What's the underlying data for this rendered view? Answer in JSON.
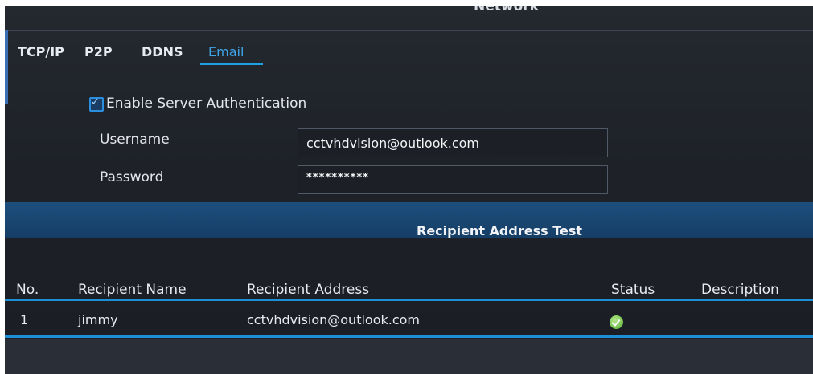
{
  "window": {
    "title": "Network"
  },
  "tabs": [
    {
      "label": "TCP/IP",
      "active": false
    },
    {
      "label": "P2P",
      "active": false
    },
    {
      "label": "DDNS",
      "active": false
    },
    {
      "label": "Email",
      "active": true
    }
  ],
  "auth": {
    "enable_label": "Enable Server Authentication",
    "enabled": true,
    "username_label": "Username",
    "username_value": "cctvhdvision@outlook.com",
    "password_label": "Password",
    "password_value": "**********"
  },
  "recipient_section": {
    "title": "Recipient Address Test",
    "columns": [
      "No.",
      "Recipient Name",
      "Recipient Address",
      "Status",
      "Description"
    ],
    "rows": [
      {
        "no": "1",
        "name": "jimmy",
        "address": "cctvhdvision@outlook.com",
        "status": "ok-icon",
        "description": ""
      }
    ]
  },
  "colors": {
    "accent": "#1fa0e3",
    "section_bar": "#1a4874",
    "status_ok": "#7ac653"
  }
}
